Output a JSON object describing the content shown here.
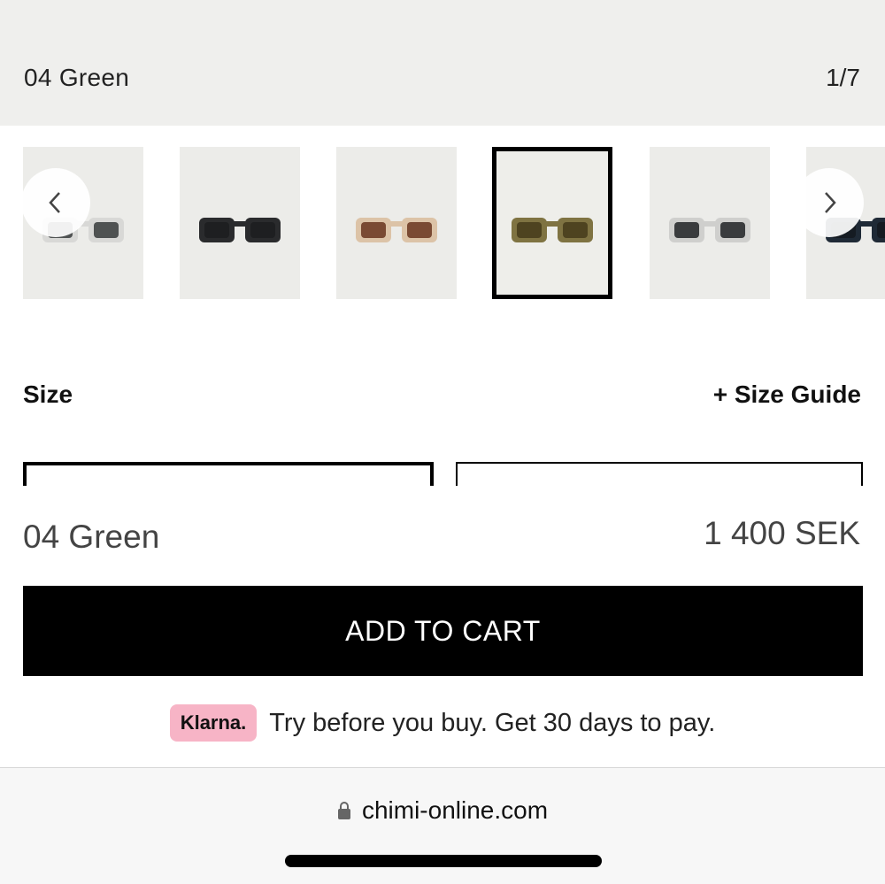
{
  "header": {
    "variant_name": "04 Green",
    "image_counter": "1/7"
  },
  "gallery": {
    "prev_icon": "chevron-left-icon",
    "next_icon": "chevron-right-icon",
    "thumbnails": [
      {
        "variant": "clear",
        "frame_color": "#d8d8d6",
        "lens_color": "#4f5252",
        "selected": false
      },
      {
        "variant": "black",
        "frame_color": "#2a2b2d",
        "lens_color": "#1e1f21",
        "selected": false
      },
      {
        "variant": "beige",
        "frame_color": "#dcc3a7",
        "lens_color": "#7a4a33",
        "selected": false
      },
      {
        "variant": "green",
        "frame_color": "#7f7342",
        "lens_color": "#4e4320",
        "selected": true
      },
      {
        "variant": "grey",
        "frame_color": "#cfcfcd",
        "lens_color": "#3a3c3e",
        "selected": false
      },
      {
        "variant": "navy",
        "frame_color": "#1f2a36",
        "lens_color": "#151b22",
        "selected": false
      }
    ]
  },
  "size": {
    "label": "Size",
    "guide_link": "+ Size Guide"
  },
  "product": {
    "name": "04 Green",
    "price": "1 400 SEK"
  },
  "cart": {
    "add_label": "ADD TO CART"
  },
  "klarna": {
    "badge": "Klarna.",
    "text": "Try before you buy. Get 30 days to pay."
  },
  "browser": {
    "url": "chimi-online.com",
    "lock_icon": "lock-icon"
  },
  "colors": {
    "accent": "#000000",
    "klarna_pink": "#f7b4c6",
    "header_bg": "#efefed"
  }
}
